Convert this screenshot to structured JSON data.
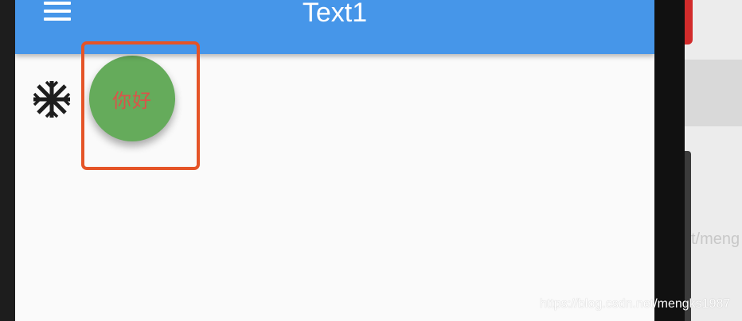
{
  "appbar": {
    "title": "Text1",
    "menu_icon": "menu-icon",
    "background_color": "#4696e9",
    "title_color": "#ffffff"
  },
  "body": {
    "leading_icon": "ac-unit-snowflake-icon",
    "avatar": {
      "label": "你好",
      "background_color": "#65ab5b",
      "label_color": "#d9544a"
    },
    "highlight_color": "#e55427"
  },
  "background": {
    "faint_text": "t/meng"
  },
  "watermark": "https://blog.csdn.net/mengks1987"
}
